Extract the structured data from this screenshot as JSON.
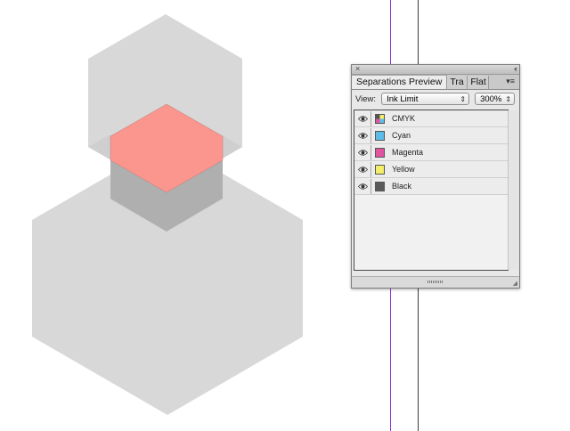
{
  "panel": {
    "close_icon": "×",
    "collapse_icon": "‹‹",
    "tabs": [
      {
        "label": "Separations Preview",
        "active": true
      },
      {
        "label": "Tra",
        "active": false
      },
      {
        "label": "Flat",
        "active": false
      }
    ],
    "menu_icon": "▾≡",
    "view_label": "View:",
    "view_value": "Ink Limit",
    "zoom_value": "300%",
    "separations": [
      {
        "label": "CMYK",
        "color": "cmyk"
      },
      {
        "label": "Cyan",
        "color": "#5cbde8"
      },
      {
        "label": "Magenta",
        "color": "#e0559e"
      },
      {
        "label": "Yellow",
        "color": "#f4ef6a"
      },
      {
        "label": "Black",
        "color": "#5a5a5a"
      }
    ]
  },
  "artwork": {
    "hex_light_color": "#d8d8d8",
    "hex_overlap_color": "#afafaf",
    "hex_red_color": "#fa968e"
  }
}
